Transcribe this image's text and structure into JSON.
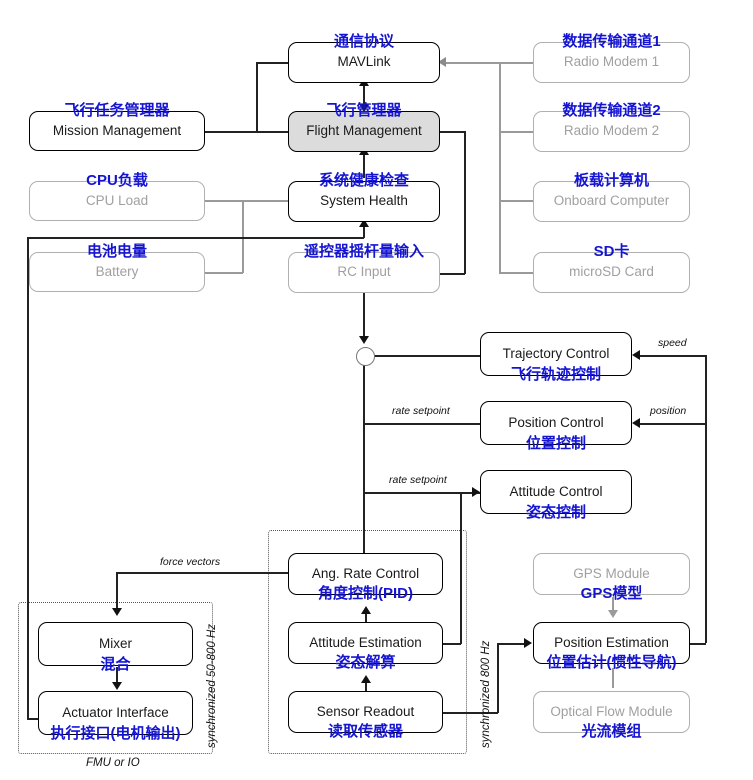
{
  "diagram": {
    "title": "PX4 Flight Stack Architecture (Chinese annotated)",
    "colors": {
      "chinese_label": "#1414d2",
      "active_node_fill": "#dcdcdc",
      "inactive_border": "#b0b0b0",
      "line": "#222222",
      "grey_line": "#9a9a9a"
    }
  },
  "nodes": {
    "mavlink": {
      "en": "MAVLink",
      "cn": "通信协议"
    },
    "flight_management": {
      "en": "Flight Management",
      "cn": "飞行管理器"
    },
    "mission_management": {
      "en": "Mission Management",
      "cn": "飞行任务管理器"
    },
    "system_health": {
      "en": "System Health",
      "cn": "系统健康检查"
    },
    "cpu_load": {
      "en": "CPU Load",
      "cn": "CPU负载"
    },
    "battery": {
      "en": "Battery",
      "cn": "电池电量"
    },
    "rc_input": {
      "en": "RC Input",
      "cn": "遥控器摇杆量输入"
    },
    "radio_modem_1": {
      "en": "Radio Modem 1",
      "cn": "数据传输通道1"
    },
    "radio_modem_2": {
      "en": "Radio Modem 2",
      "cn": "数据传输通道2"
    },
    "onboard_computer": {
      "en": "Onboard Computer",
      "cn": "板载计算机"
    },
    "microsd_card": {
      "en": "microSD Card",
      "cn": "SD卡"
    },
    "trajectory_control": {
      "en": "Trajectory Control",
      "cn": "飞行轨迹控制"
    },
    "position_control": {
      "en": "Position Control",
      "cn": "位置控制"
    },
    "attitude_control": {
      "en": "Attitude Control",
      "cn": "姿态控制"
    },
    "ang_rate_control": {
      "en": "Ang. Rate Control",
      "cn": "角度控制(PID)"
    },
    "attitude_estimation": {
      "en": "Attitude Estimation",
      "cn": "姿态解算"
    },
    "sensor_readout": {
      "en": "Sensor Readout",
      "cn": "读取传感器"
    },
    "mixer": {
      "en": "Mixer",
      "cn": "混合"
    },
    "actuator_interface": {
      "en": "Actuator Interface",
      "cn": "执行接口(电机输出)"
    },
    "gps_module": {
      "en": "GPS Module",
      "cn": "GPS模型"
    },
    "position_estimation": {
      "en": "Position Estimation",
      "cn": "位置估计(惯性导航)"
    },
    "optical_flow": {
      "en": "Optical Flow Module",
      "cn": "光流模组"
    }
  },
  "groups": {
    "fmu_io": {
      "label": "FMU or IO",
      "rate": "synchronized 50-800 Hz"
    },
    "sync_800": {
      "label": "",
      "rate": "synchronized 800 Hz"
    }
  },
  "edge_labels": {
    "speed": "speed",
    "position": "position",
    "rate_setpoint_1": "rate setpoint",
    "rate_setpoint_2": "rate setpoint",
    "force_vectors": "force vectors"
  }
}
